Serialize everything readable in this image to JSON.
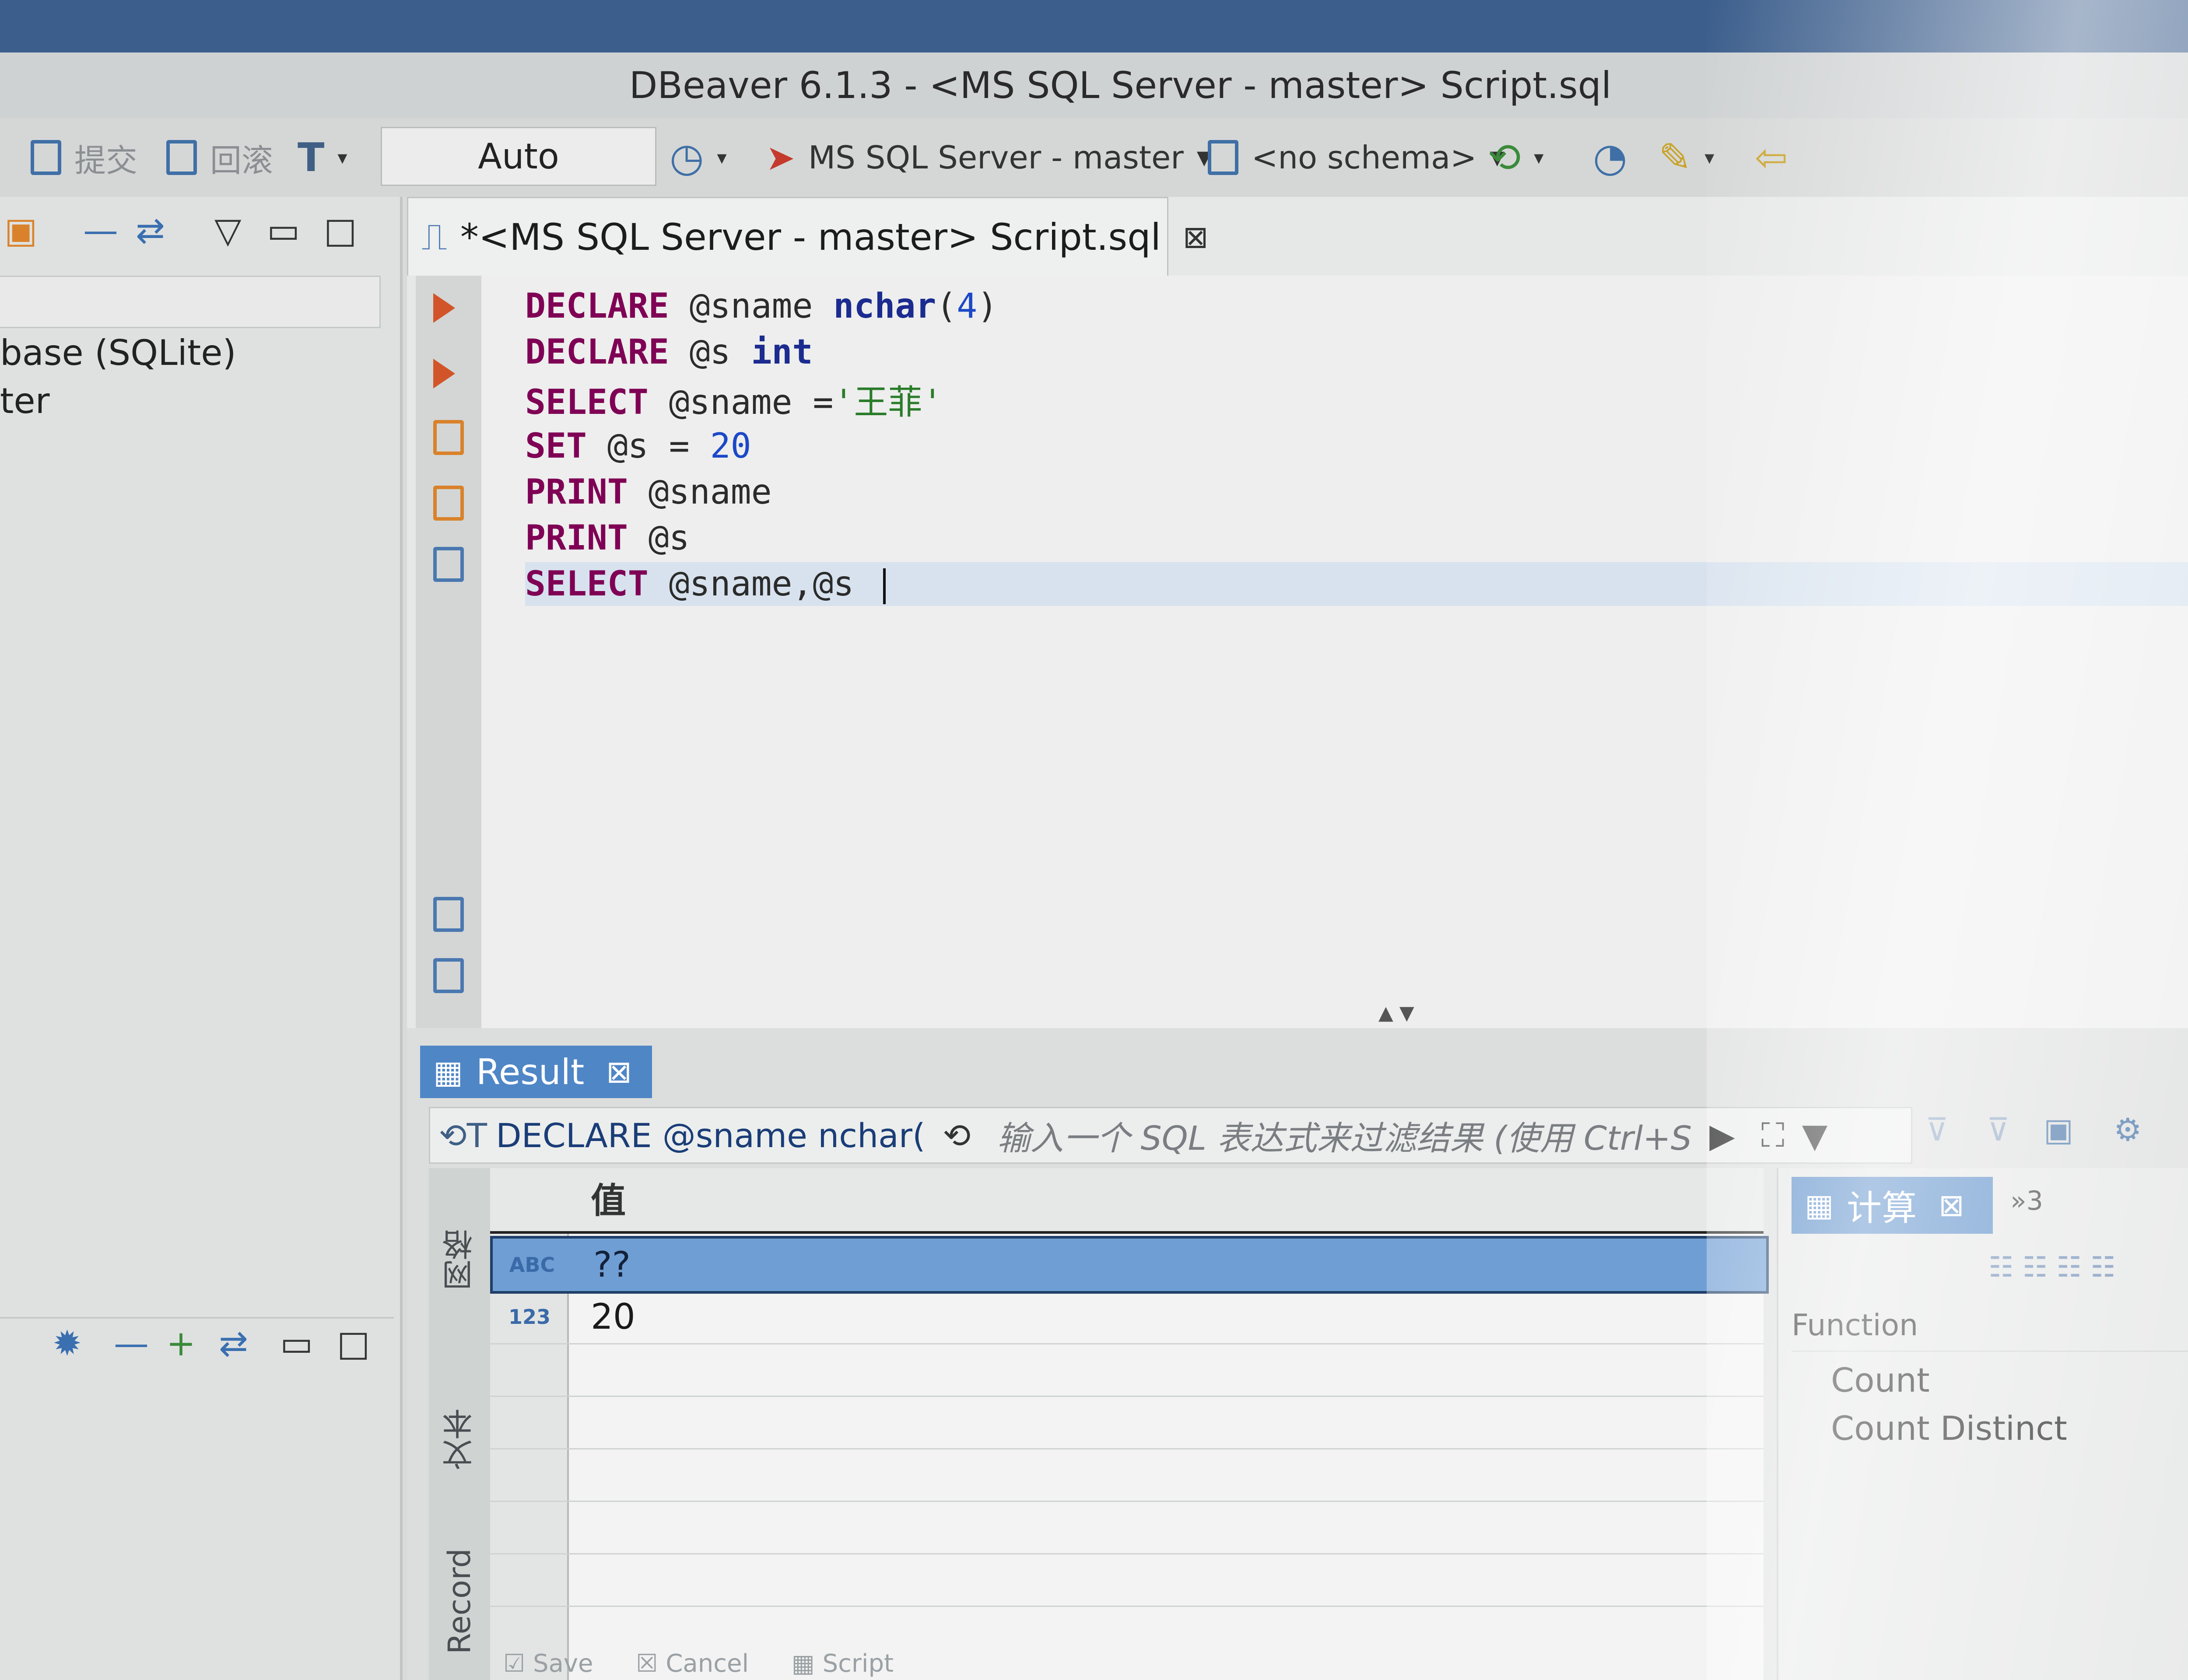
{
  "window": {
    "title": "DBeaver 6.1.3 - <MS SQL Server - master> Script.sql"
  },
  "toolbar": {
    "commit_label": "提交",
    "rollback_label": "回滚",
    "tx_mode": "Auto",
    "connection": "MS SQL Server - master",
    "schema": "<no schema>"
  },
  "navigator": {
    "items": [
      "base (SQLite)",
      "ter"
    ]
  },
  "editor": {
    "tab_label": "*<MS SQL Server - master> Script.sql",
    "lines": [
      {
        "kw": "DECLARE",
        "rest": " @sname ",
        "type": "nchar",
        "paren_open": "(",
        "num": "4",
        "paren_close": ")"
      },
      {
        "kw": "DECLARE",
        "rest": " @s ",
        "type": "int"
      },
      {
        "kw": "SELECT",
        "rest": " @sname =",
        "str": "'王菲'"
      },
      {
        "kw": "SET",
        "rest": " @s = ",
        "num": "20"
      },
      {
        "kw": "PRINT",
        "rest": " @sname"
      },
      {
        "kw": "PRINT",
        "rest": " @s"
      },
      {
        "kw": "SELECT",
        "rest": " @sname,@s "
      }
    ]
  },
  "results": {
    "tab_label": "Result",
    "filter_query": "DECLARE @sname nchar(",
    "filter_placeholder": "输入一个 SQL 表达式来过滤结果 (使用 Ctrl+S",
    "side_tabs": {
      "grid": "网格",
      "text": "文本",
      "record": "Record"
    },
    "column_header": "值",
    "rows": [
      {
        "type": "ABC",
        "value": "??"
      },
      {
        "type": "123",
        "value": "20"
      }
    ],
    "bottom_actions": {
      "save": "Save",
      "cancel": "Cancel",
      "script": "Script"
    }
  },
  "calc_panel": {
    "tab_label": "计算",
    "more_label": "»3",
    "header": "Function",
    "items": [
      "Count",
      "Count Distinct"
    ]
  }
}
